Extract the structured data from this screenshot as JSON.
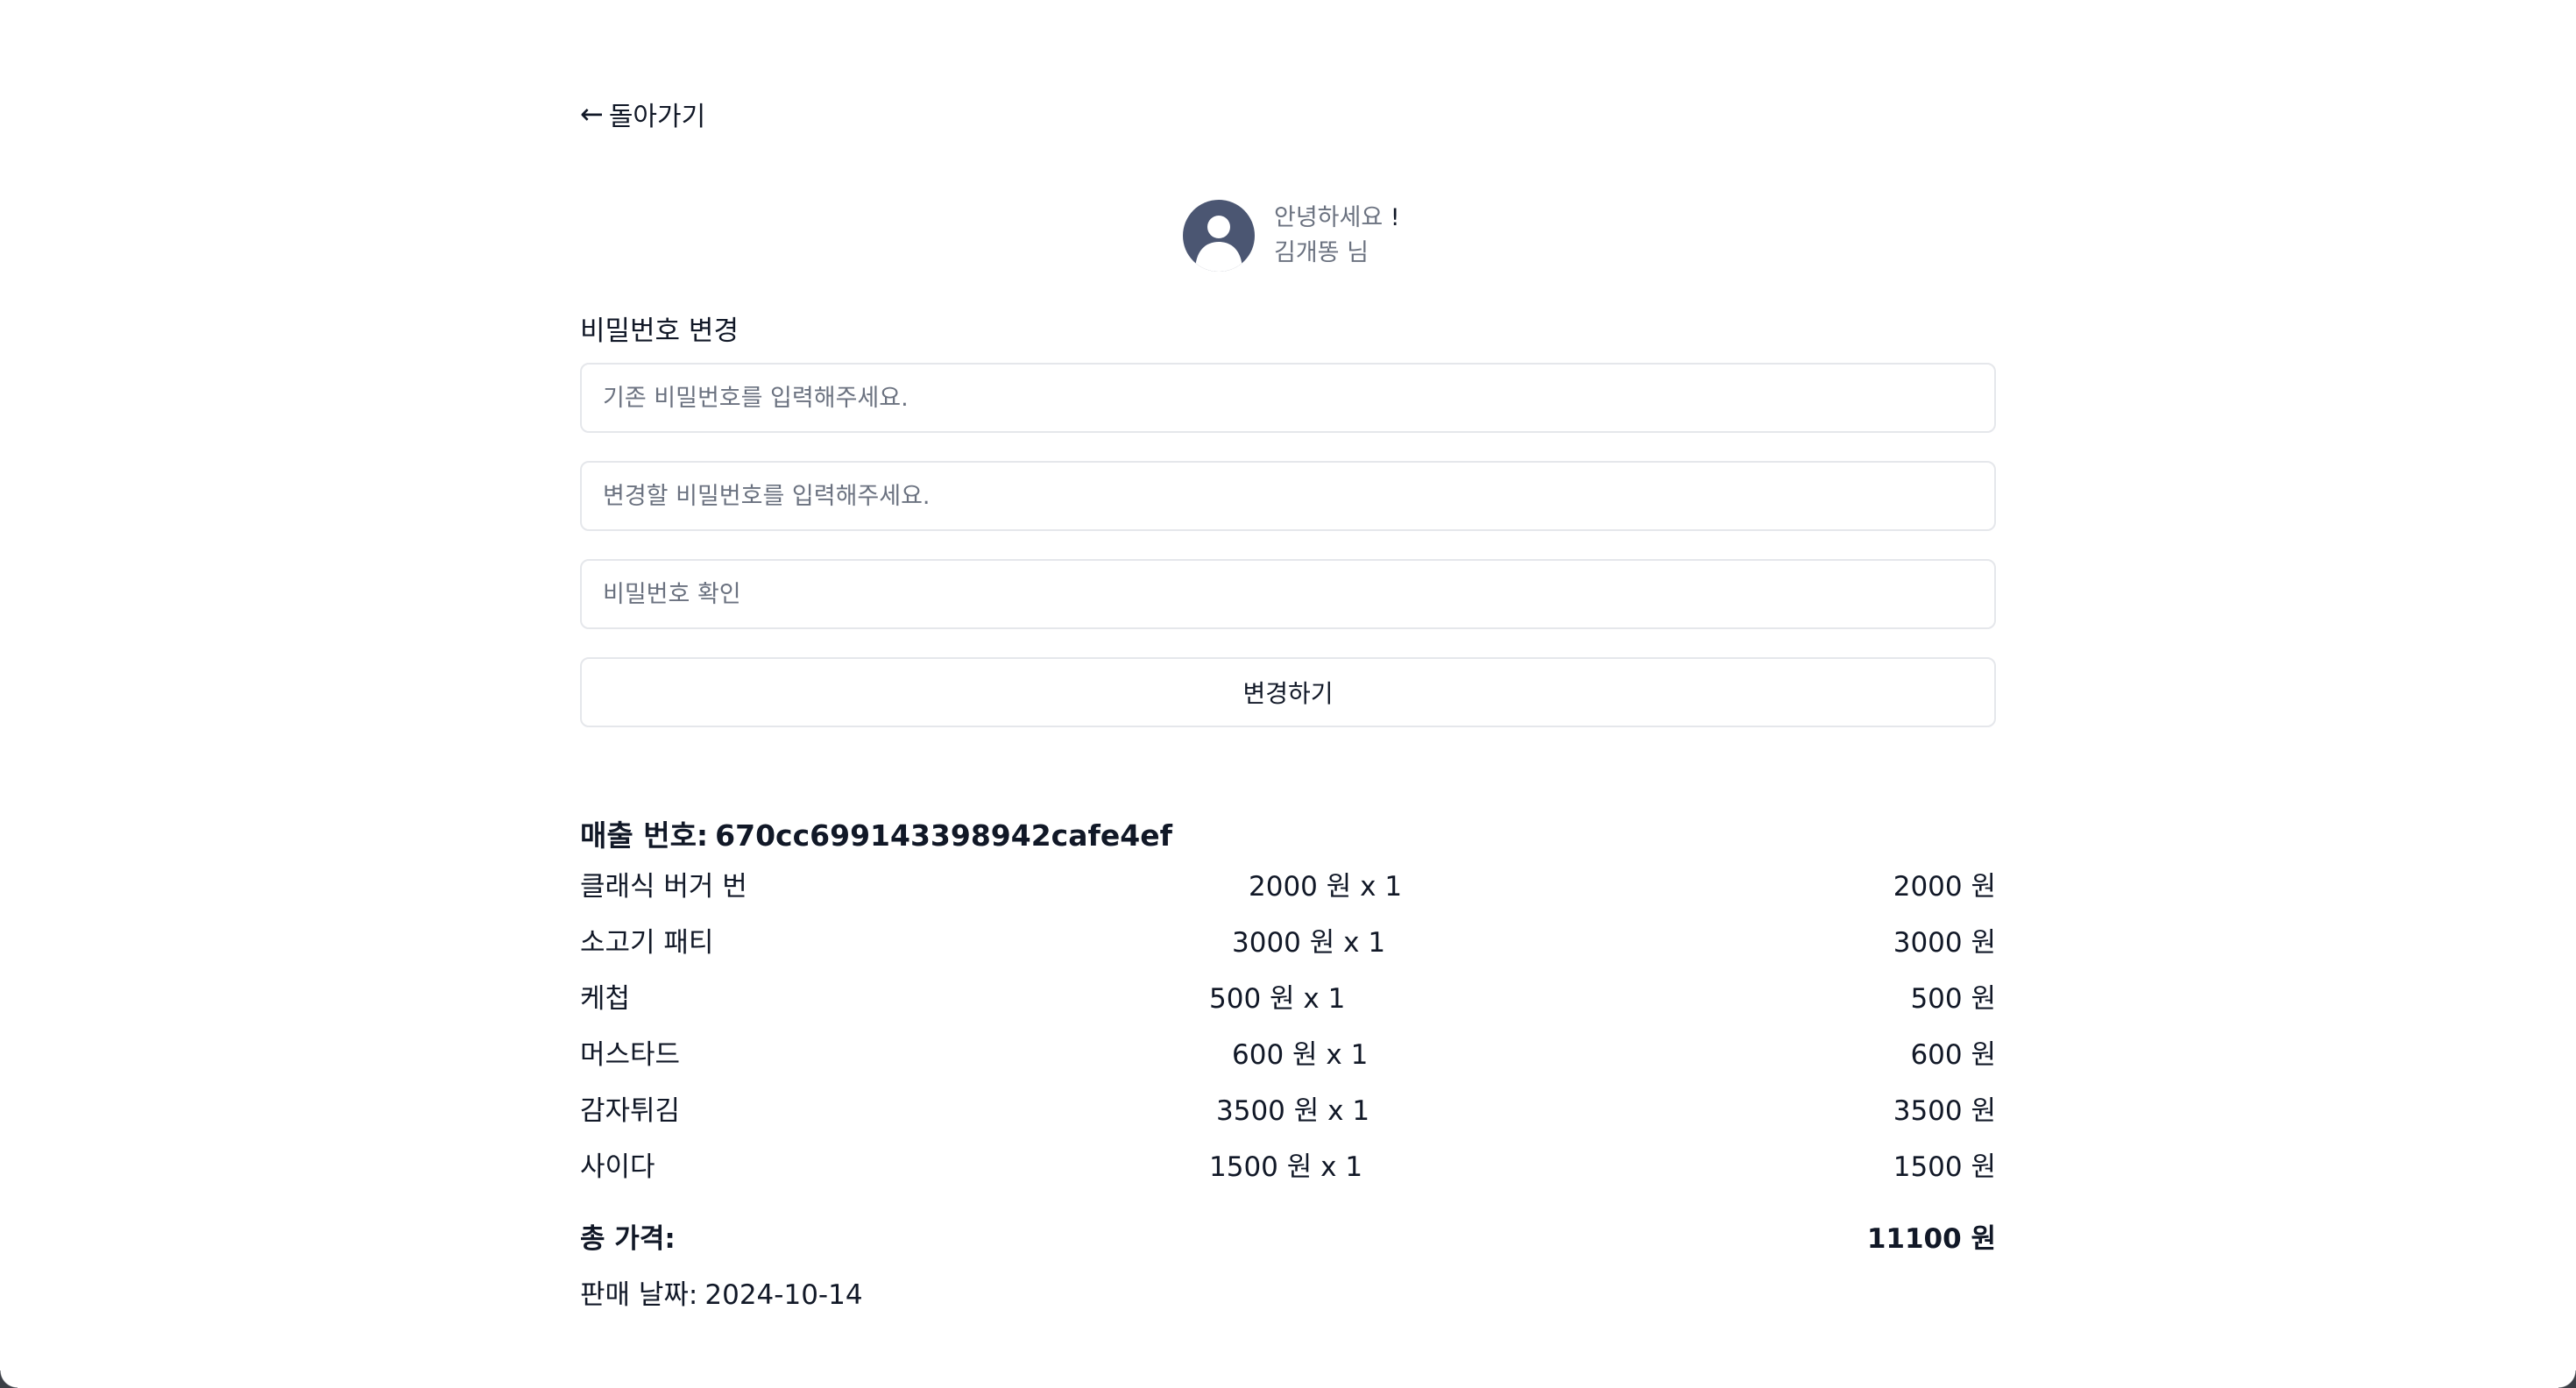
{
  "back": {
    "label": "돌아가기",
    "icon": "arrow-left-icon"
  },
  "profile": {
    "avatar_icon": "user-avatar-icon",
    "greeting": "안녕하세요",
    "bang": "!",
    "user_name": "김개똥 님"
  },
  "password_change": {
    "title": "비밀번호 변경",
    "current_placeholder": "기존 비밀번호를 입력해주세요.",
    "new_placeholder": "변경할 비밀번호를 입력해주세요.",
    "confirm_placeholder": "비밀번호 확인",
    "submit_label": "변경하기"
  },
  "order": {
    "number_label": "매출 번호:",
    "number_value": "670cc699143398942cafe4ef",
    "items": [
      {
        "name": "클래식 버거 번",
        "qty": "2000 원 x 1",
        "price": "2000 원"
      },
      {
        "name": "소고기 패티",
        "qty": "3000 원 x 1",
        "price": "3000 원"
      },
      {
        "name": "케첩",
        "qty": "500 원 x 1",
        "price": "500 원"
      },
      {
        "name": "머스타드",
        "qty": "600 원 x 1",
        "price": "600 원"
      },
      {
        "name": "감자튀김",
        "qty": "3500 원 x 1",
        "price": "3500 원"
      },
      {
        "name": "사이다",
        "qty": "1500 원 x 1",
        "price": "1500 원"
      }
    ],
    "total_label": "총 가격:",
    "total_amount": "11100 원",
    "sale_date_label": "판매 날짜:",
    "sale_date_value": "2024-10-14"
  },
  "colors": {
    "avatar_bg": "#4b5672",
    "border": "#e5e7eb",
    "muted_text": "#6b7280",
    "text": "#111827"
  }
}
